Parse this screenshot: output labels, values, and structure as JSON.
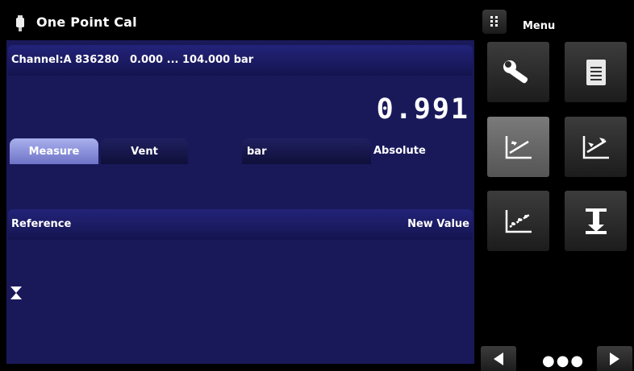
{
  "title_bar": {
    "title": "One Point Cal",
    "icon": "pressure-transducer-icon"
  },
  "channel": {
    "info": "Channel:A 836280   0.000 ... 104.000 bar"
  },
  "reading": {
    "value": "0.991"
  },
  "controls": {
    "measure_label": "Measure",
    "vent_label": "Vent",
    "unit_label": "bar",
    "mode_label": "Absolute"
  },
  "reference_table": {
    "left_header": "Reference",
    "right_header": "New Value"
  },
  "sidebar": {
    "menu_icon": "grid-dots-icon",
    "menu_label": "Menu",
    "tiles": [
      {
        "icon": "wrench-icon",
        "active": false
      },
      {
        "icon": "document-icon",
        "active": false
      },
      {
        "icon": "one-point-cal-icon",
        "active": true
      },
      {
        "icon": "two-point-cal-icon",
        "active": false
      },
      {
        "icon": "linearization-icon",
        "active": false
      },
      {
        "icon": "zero-icon",
        "active": false
      }
    ],
    "pager_dots": "●●●"
  },
  "colors": {
    "panel_bg": "#19195a",
    "header_bg": "#1c1c6a",
    "active_button": "#8f95db"
  }
}
